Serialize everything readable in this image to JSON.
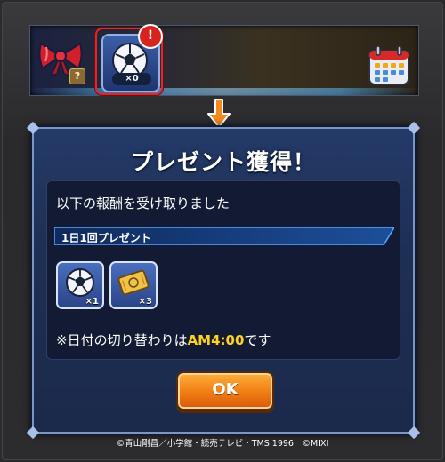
{
  "top_bar": {
    "slots": [
      {
        "name": "bow",
        "badge": "?"
      },
      {
        "name": "soccer-ball",
        "count": "×0",
        "alert": "!"
      },
      {
        "name": "calendar"
      }
    ]
  },
  "dialog": {
    "title": "プレゼント獲得！",
    "message": "以下の報酬を受け取りました",
    "section_label": "1日1回プレゼント",
    "rewards": [
      {
        "icon": "soccer-ball-icon",
        "qty": "×1"
      },
      {
        "icon": "ticket-icon",
        "qty": "×3"
      }
    ],
    "note_prefix": "※日付の切り替わりは",
    "note_time": "AM4:00",
    "note_suffix": "です",
    "ok_label": "OK"
  },
  "footer": {
    "copyright": "©青山剛昌／小学館・読売テレビ・TMS 1996　©MIXI"
  },
  "colors": {
    "accent_orange": "#f07c14",
    "highlight_yellow": "#ffd21f",
    "alert_red": "#d8231d",
    "dialog_blue": "#1e2f55"
  }
}
